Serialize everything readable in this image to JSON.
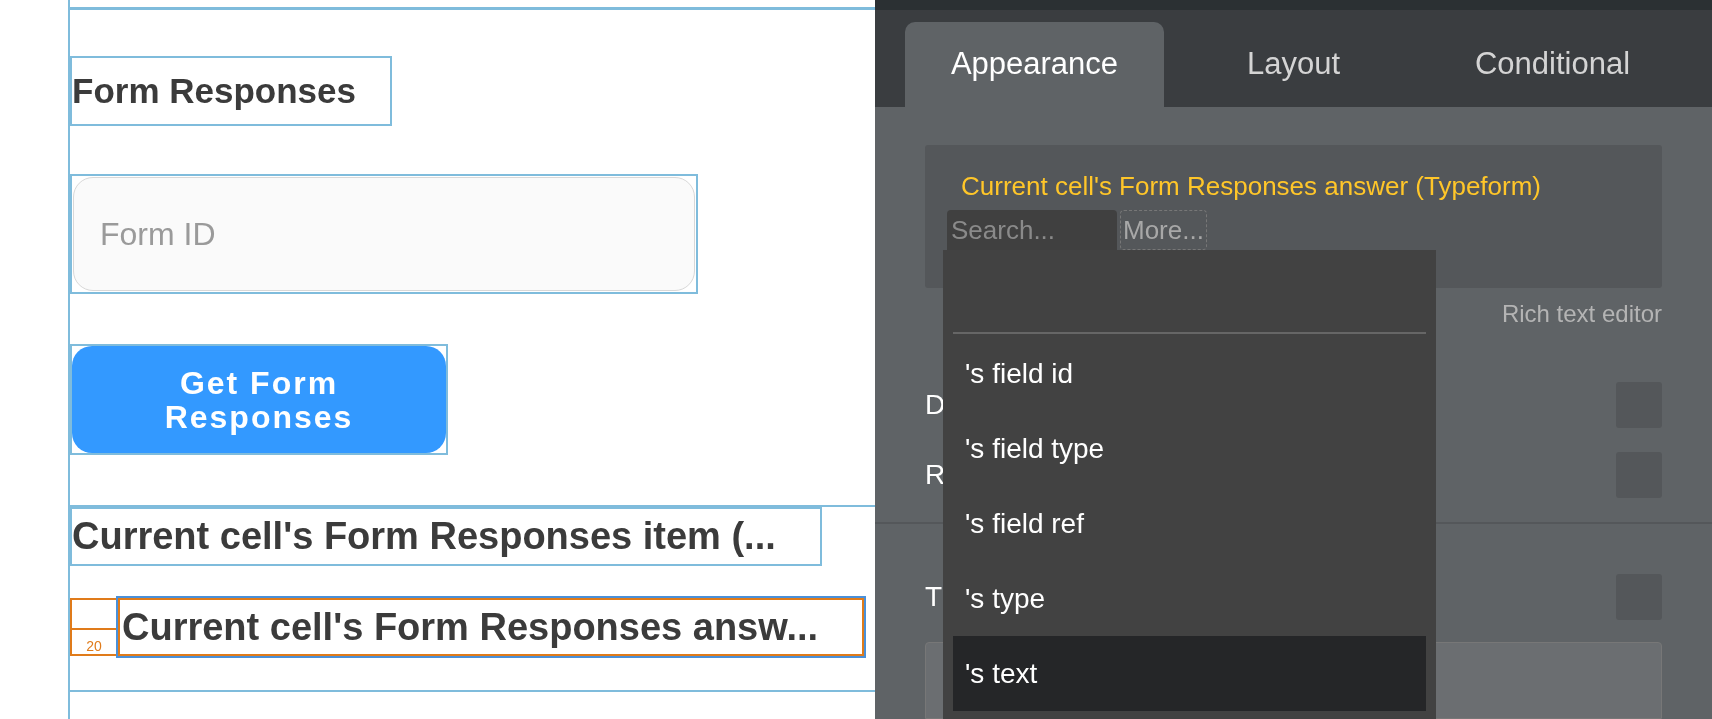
{
  "canvas": {
    "heading": "Form Responses",
    "form_id_input": {
      "placeholder": "Form ID"
    },
    "button": "Get Form Responses",
    "item_text": "Current cell's Form Responses item (...",
    "answer_row": {
      "marker": "20",
      "text": "Current cell's Form Responses answ..."
    }
  },
  "panel": {
    "tabs": [
      {
        "label": "Appearance",
        "selected": true
      },
      {
        "label": "Layout",
        "selected": false
      },
      {
        "label": "Conditional",
        "selected": false
      }
    ],
    "expression": "Current cell's Form Responses answer (Typeform)",
    "search": {
      "placeholder": "Search..."
    },
    "more": "More...",
    "rich_text_link": "Rich text editor",
    "rows": [
      {
        "label": "D",
        "checked": false
      },
      {
        "label": "R",
        "checked": false
      },
      {
        "label": "T",
        "checked": false
      }
    ],
    "dropdown": {
      "items": [
        {
          "label": "'s field id",
          "selected": false
        },
        {
          "label": "'s field type",
          "selected": false
        },
        {
          "label": "'s field ref",
          "selected": false
        },
        {
          "label": "'s type",
          "selected": false
        },
        {
          "label": "'s text",
          "selected": true
        }
      ]
    }
  }
}
